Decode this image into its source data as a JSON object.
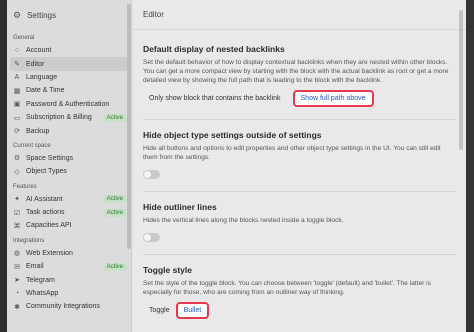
{
  "sidebar": {
    "title": "Settings",
    "sections": [
      {
        "label": "General",
        "items": [
          {
            "label": "Account",
            "icon": "user-icon"
          },
          {
            "label": "Editor",
            "icon": "editor-icon",
            "active": true
          },
          {
            "label": "Language",
            "icon": "language-icon"
          },
          {
            "label": "Date & Time",
            "icon": "calendar-icon"
          },
          {
            "label": "Password & Authentication",
            "icon": "lock-icon"
          },
          {
            "label": "Subscription & Billing",
            "icon": "card-icon",
            "badge": "Active"
          },
          {
            "label": "Backup",
            "icon": "backup-icon"
          }
        ]
      },
      {
        "label": "Current space",
        "items": [
          {
            "label": "Space Settings",
            "icon": "gear-icon"
          },
          {
            "label": "Object Types",
            "icon": "cube-icon"
          }
        ]
      },
      {
        "label": "Features",
        "items": [
          {
            "label": "AI Assistant",
            "icon": "ai-icon",
            "badge": "Active"
          },
          {
            "label": "Task actions",
            "icon": "task-icon",
            "badge": "Active"
          },
          {
            "label": "Capacities API",
            "icon": "api-icon"
          }
        ]
      },
      {
        "label": "Integrations",
        "items": [
          {
            "label": "Web Extension",
            "icon": "globe-icon"
          },
          {
            "label": "Email",
            "icon": "email-icon",
            "badge": "Active"
          },
          {
            "label": "Telegram",
            "icon": "telegram-icon"
          },
          {
            "label": "WhatsApp",
            "icon": "whatsapp-icon"
          },
          {
            "label": "Community Integrations",
            "icon": "community-icon"
          }
        ]
      }
    ]
  },
  "main": {
    "header": "Editor",
    "sections": [
      {
        "title": "Default display of nested backlinks",
        "description": "Set the default behavior of how to display contextual backlinks when they are nested within other blocks. You can get a more compact view by starting with the block with the actual backlink as root or get a more detailed view by showing the full path that is leading to the block with the backlink.",
        "options": [
          "Only show block that contains the backlink",
          "Show full path above"
        ],
        "selected": 1
      },
      {
        "title": "Hide object type settings outside of settings",
        "description": "Hide all buttons and options to edit properties and other object type settings in the UI. You can still edit them from the settings.",
        "toggle": false
      },
      {
        "title": "Hide outliner lines",
        "description": "Hides the vertical lines along the blocks nested inside a toggle block.",
        "toggle": false
      },
      {
        "title": "Toggle style",
        "description": "Set the style of the toggle block. You can choose between 'toggle' (default) and 'bullet'. The latter is especially for those, who are coming from an outliner way of thinking.",
        "options": [
          "Toggle",
          "Bullet"
        ],
        "selected": 1
      }
    ]
  },
  "icons": {
    "settings": "gear-icon"
  }
}
